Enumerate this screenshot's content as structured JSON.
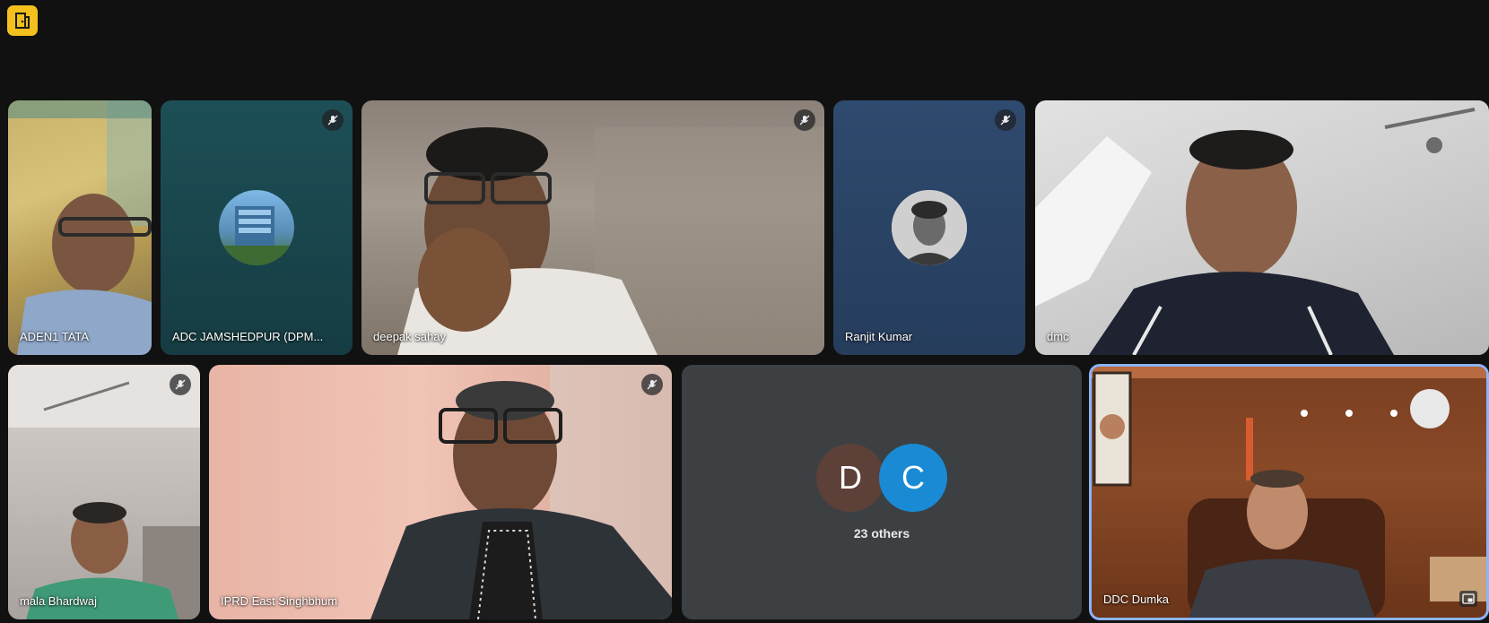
{
  "app": {
    "badge_icon": "room-door-icon"
  },
  "participants": [
    {
      "name": "ADEN1 TATA",
      "muted": false
    },
    {
      "name": "ADC JAMSHEDPUR (DPM...",
      "muted": true
    },
    {
      "name": "deepak sahay",
      "muted": true
    },
    {
      "name": "Ranjit Kumar",
      "muted": true
    },
    {
      "name": "dmc",
      "muted": false
    },
    {
      "name": "mala Bhardwaj",
      "muted": true
    },
    {
      "name": "IPRD East Singhbhum",
      "muted": true
    },
    {
      "name": "DDC Dumka",
      "muted": false,
      "active_speaker": true
    }
  ],
  "others_tile": {
    "bubbles": [
      {
        "letter": "D",
        "color": "#5d4037"
      },
      {
        "letter": "C",
        "color": "#1a8ad4"
      }
    ],
    "count_label": "23 others"
  },
  "colors": {
    "background": "#111111",
    "badge": "#f4c01e",
    "active_border": "#8ab4f8",
    "others_tile": "#3c4043"
  }
}
